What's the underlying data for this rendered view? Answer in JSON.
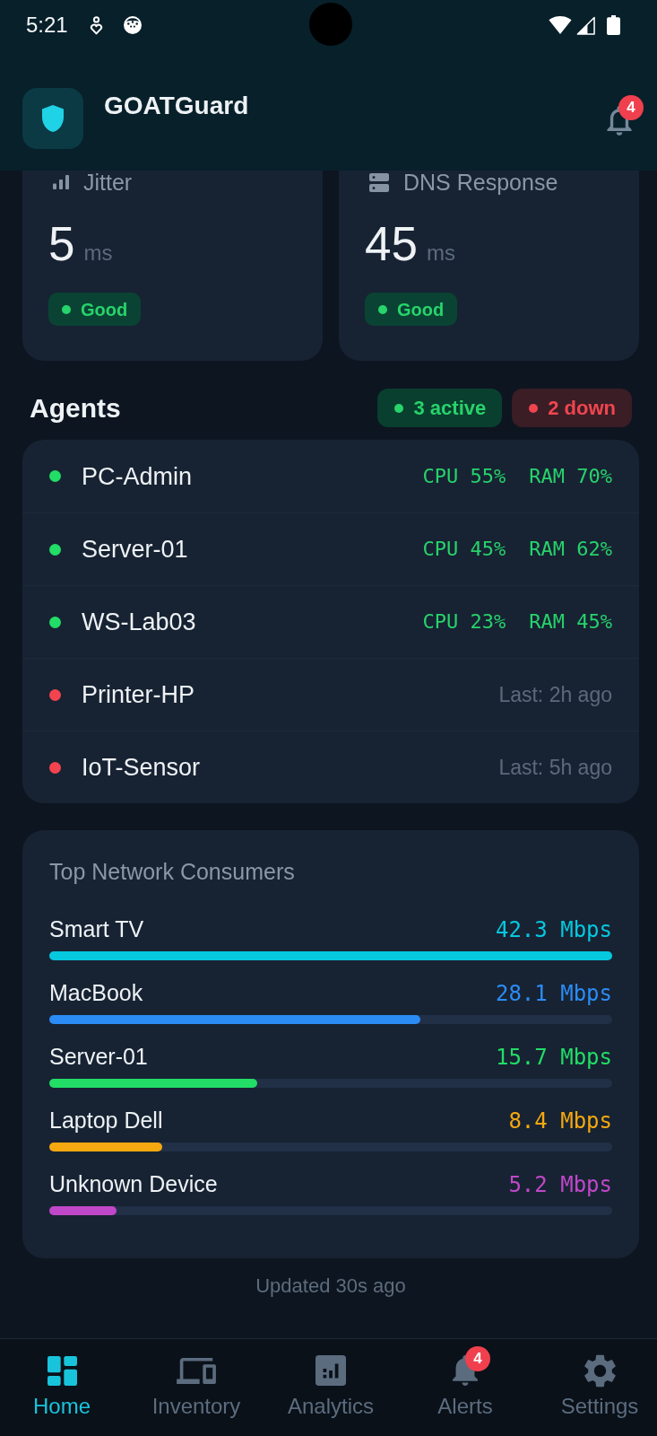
{
  "status_bar": {
    "time": "5:21"
  },
  "header": {
    "title": "GOATGuard",
    "notifications": "4"
  },
  "metrics": [
    {
      "label": "Jitter",
      "value": "5",
      "unit": "ms",
      "status": {
        "label": "Good",
        "kind": "good"
      }
    },
    {
      "label": "DNS Response",
      "value": "45",
      "unit": "ms",
      "status": {
        "label": "Good",
        "kind": "good"
      }
    }
  ],
  "agents": {
    "title": "Agents",
    "summary": [
      {
        "label": "3 active",
        "kind": "up"
      },
      {
        "label": "2 down",
        "kind": "down"
      }
    ],
    "items": [
      {
        "name": "PC-Admin",
        "online": true,
        "cpu": "CPU 55%",
        "ram": "RAM 70%"
      },
      {
        "name": "Server-01",
        "online": true,
        "cpu": "CPU 45%",
        "ram": "RAM 62%"
      },
      {
        "name": "WS-Lab03",
        "online": true,
        "cpu": "CPU 23%",
        "ram": "RAM 45%"
      },
      {
        "name": "Printer-HP",
        "online": false,
        "last_seen": "Last: 2h ago"
      },
      {
        "name": "IoT-Sensor",
        "online": false,
        "last_seen": "Last: 5h ago"
      }
    ]
  },
  "consumers": {
    "title": "Top Network Consumers",
    "items": [
      {
        "name": "Smart TV",
        "rate": "42.3 Mbps",
        "level": 1,
        "color": "#06c8df"
      },
      {
        "name": "MacBook",
        "rate": "28.1 Mbps",
        "level": 0.66,
        "color": "#2b8cf5"
      },
      {
        "name": "Server-01",
        "rate": "15.7 Mbps",
        "level": 0.37,
        "color": "#22dd66"
      },
      {
        "name": "Laptop Dell",
        "rate": "8.4 Mbps",
        "level": 0.2,
        "color": "#f5a80f"
      },
      {
        "name": "Unknown Device",
        "rate": "5.2 Mbps",
        "level": 0.12,
        "color": "#c047c9"
      }
    ]
  },
  "updated": "Updated 30s ago",
  "nav": [
    {
      "label": "Home",
      "selected": true
    },
    {
      "label": "Inventory",
      "selected": false
    },
    {
      "label": "Analytics",
      "selected": false
    },
    {
      "label": "Alerts",
      "selected": false,
      "badge": "4"
    },
    {
      "label": "Settings",
      "selected": false
    }
  ]
}
